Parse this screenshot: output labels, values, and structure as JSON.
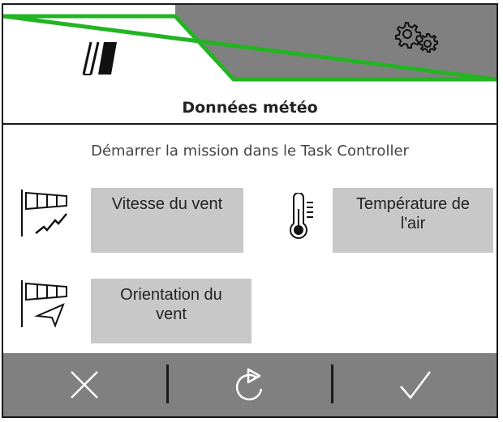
{
  "header": {
    "tabs": [
      {
        "icon": "tramline-icon",
        "active": true
      },
      {
        "icon": "gears-icon",
        "active": false
      }
    ],
    "accent_color": "#22b422"
  },
  "title": "Données météo",
  "mission_text": "Démarrer la mission dans le Task Controller",
  "weather_buttons": {
    "wind_speed": {
      "label_line1": "Vitesse du vent",
      "label_line2": "",
      "icon": "wind-speed-icon"
    },
    "air_temperature": {
      "label_line1": "Température de",
      "label_line2": "l'air",
      "icon": "thermometer-icon"
    },
    "wind_direction": {
      "label_line1": "Orientation du",
      "label_line2": "vent",
      "icon": "wind-direction-icon"
    }
  },
  "footer": {
    "buttons": [
      {
        "icon": "close-icon"
      },
      {
        "icon": "refresh-icon"
      },
      {
        "icon": "check-icon"
      }
    ]
  }
}
